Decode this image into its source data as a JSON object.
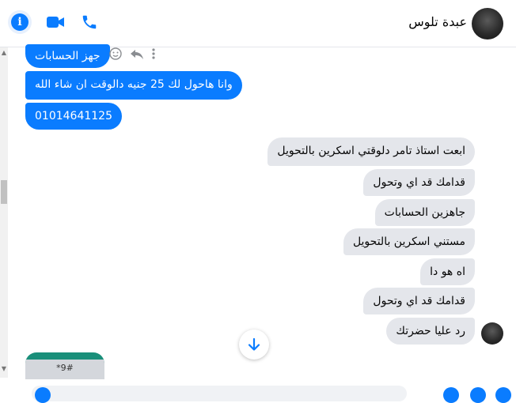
{
  "header": {
    "contact_name": "عبدة تلوس",
    "icons": [
      "info-icon",
      "video-call-icon",
      "phone-call-icon"
    ]
  },
  "messages": [
    {
      "direction": "outgoing",
      "text": "جهز الحسابات"
    },
    {
      "direction": "outgoing",
      "text": "وانا هاحول لك 25 جنيه دالوقت ان شاء الله"
    },
    {
      "direction": "outgoing",
      "text": "01014641125"
    },
    {
      "direction": "incoming",
      "text": "ابعت استاذ تامر دلوقتي اسكرين بالتحويل"
    },
    {
      "direction": "incoming",
      "text": "قدامك قد اي وتحول"
    },
    {
      "direction": "incoming",
      "text": "جاهزين الحسابات"
    },
    {
      "direction": "incoming",
      "text": "مستني اسكرين بالتحويل"
    },
    {
      "direction": "incoming",
      "text": "اه هو دا"
    },
    {
      "direction": "incoming",
      "text": "قدامك قد اي وتحول"
    },
    {
      "direction": "incoming",
      "text": "رد عليا حضرتك"
    }
  ],
  "attachment": {
    "text": "*9#"
  },
  "colors": {
    "accent": "#0a7cff",
    "incoming_bg": "#e4e6eb"
  }
}
